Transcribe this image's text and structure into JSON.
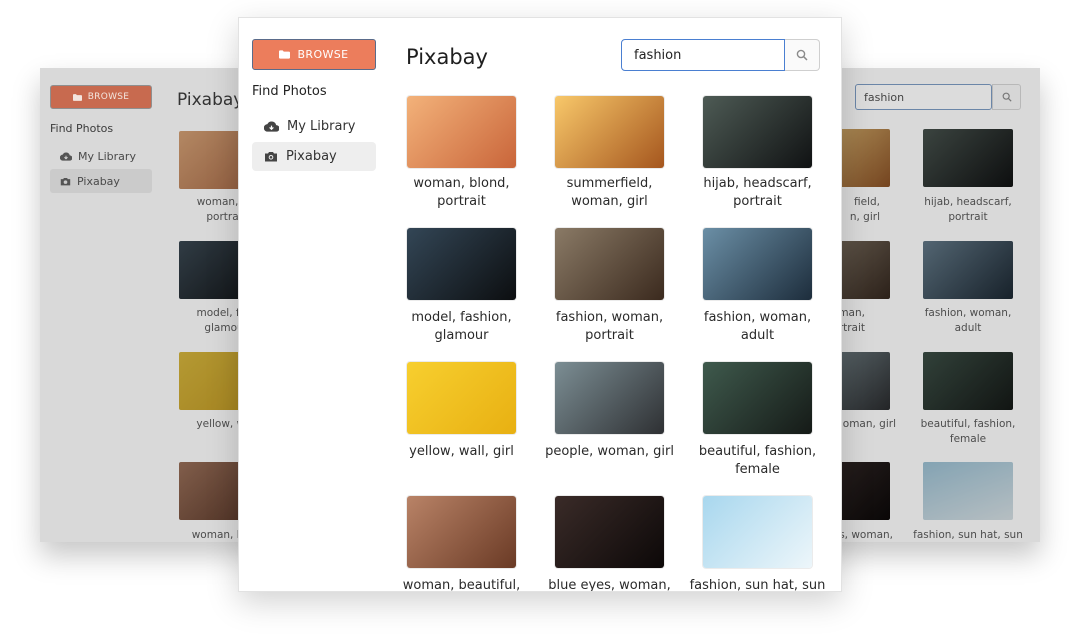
{
  "back_window": {
    "browse_label": "BROWSE",
    "find_photos": "Find Photos",
    "nav": [
      {
        "label": "My Library",
        "icon": "cloud-icon"
      },
      {
        "label": "Pixabay",
        "icon": "camera-icon"
      }
    ],
    "title": "Pixabay",
    "search_value": "fashion",
    "left_captions": [
      [
        "woman, bl",
        "portrai"
      ],
      [
        "model, fas",
        "glamou"
      ],
      [
        "yellow, wa"
      ],
      [
        "woman, bea"
      ]
    ],
    "mid_captions": [
      [
        "field,",
        "n, girl"
      ],
      [
        "oman,",
        "rtrait"
      ],
      [
        "oman, girl"
      ],
      [
        "s, woman,"
      ]
    ],
    "right_captions": [
      [
        "hijab, headscarf,",
        "portrait"
      ],
      [
        "fashion, woman,",
        "adult"
      ],
      [
        "beautiful, fashion,",
        "female"
      ],
      [
        "fashion, sun hat, sun"
      ]
    ]
  },
  "window": {
    "browse_label": "BROWSE",
    "find_photos": "Find Photos",
    "nav": [
      {
        "label": "My Library",
        "icon": "cloud-icon",
        "active": false
      },
      {
        "label": "Pixabay",
        "icon": "camera-icon",
        "active": true
      }
    ],
    "title": "Pixabay",
    "search": {
      "value": "fashion"
    },
    "photos": [
      {
        "caption": [
          "woman, blond,",
          "portrait"
        ],
        "colors": [
          "#f3b27a",
          "#c9653a"
        ]
      },
      {
        "caption": [
          "summerfield,",
          "woman, girl"
        ],
        "colors": [
          "#f8c86a",
          "#a5561e"
        ]
      },
      {
        "caption": [
          "hijab, headscarf,",
          "portrait"
        ],
        "colors": [
          "#4e5b55",
          "#101213"
        ]
      },
      {
        "caption": [
          "model, fashion,",
          "glamour"
        ],
        "colors": [
          "#334656",
          "#0c0e10"
        ]
      },
      {
        "caption": [
          "fashion, woman,",
          "portrait"
        ],
        "colors": [
          "#8a7a66",
          "#3b2a1e"
        ]
      },
      {
        "caption": [
          "fashion, woman,",
          "adult"
        ],
        "colors": [
          "#6b8fa6",
          "#1d2d3c"
        ]
      },
      {
        "caption": [
          "yellow, wall, girl"
        ],
        "colors": [
          "#f7cf2f",
          "#e8b012"
        ]
      },
      {
        "caption": [
          "people, woman, girl"
        ],
        "colors": [
          "#7c8e94",
          "#2e3033"
        ]
      },
      {
        "caption": [
          "beautiful, fashion,",
          "female"
        ],
        "colors": [
          "#3f5a4d",
          "#151a17"
        ]
      },
      {
        "caption": [
          "woman, beautiful,"
        ],
        "colors": [
          "#b98367",
          "#6a3a25"
        ]
      },
      {
        "caption": [
          "blue eyes, woman,"
        ],
        "colors": [
          "#3a2b28",
          "#0c0808"
        ]
      },
      {
        "caption": [
          "fashion, sun hat, sun"
        ],
        "colors": [
          "#a8d7ee",
          "#edf6fa"
        ]
      }
    ]
  }
}
